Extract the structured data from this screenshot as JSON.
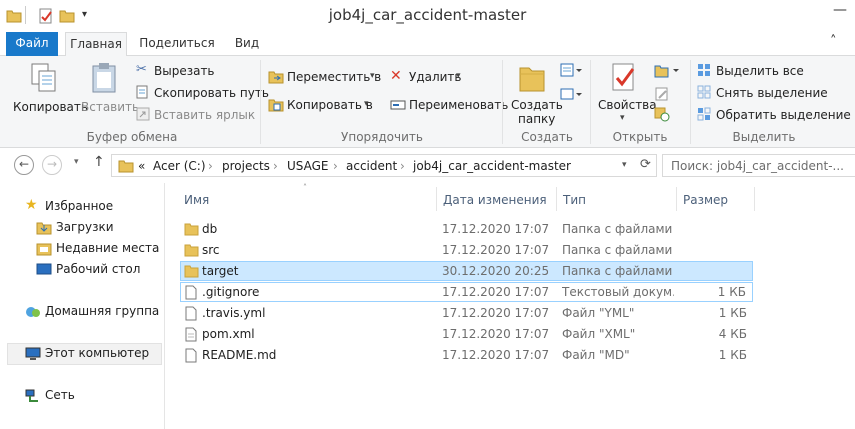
{
  "window": {
    "title": "job4j_car_accident-master",
    "minimize": "—",
    "expand_ribbon": "˄",
    "help": "?"
  },
  "ribbon_tabs": [
    "Файл",
    "Главная",
    "Поделиться",
    "Вид"
  ],
  "ribbon": {
    "clipboard": {
      "group_label": "Буфер обмена",
      "copy": "Копировать",
      "paste": "Вставить",
      "cut": "Вырезать",
      "copy_path": "Скопировать путь",
      "paste_shortcut": "Вставить ярлык"
    },
    "organize": {
      "group_label": "Упорядочить",
      "move_to": "Переместить в",
      "copy_to": "Копировать в",
      "delete": "Удалить",
      "rename": "Переименовать"
    },
    "new": {
      "group_label": "Создать",
      "new_folder_line1": "Создать",
      "new_folder_line2": "папку"
    },
    "open": {
      "group_label": "Открыть",
      "properties": "Свойства"
    },
    "select": {
      "group_label": "Выделить",
      "select_all": "Выделить все",
      "select_none": "Снять выделение",
      "invert": "Обратить выделение"
    }
  },
  "address": {
    "crumbs": [
      "«",
      "Acer (C:)",
      "projects",
      "USAGE",
      "accident",
      "job4j_car_accident-master"
    ],
    "search_placeholder": "Поиск: job4j_car_accident-..."
  },
  "nav": {
    "favorites": "Избранное",
    "downloads": "Загрузки",
    "recent": "Недавние места",
    "desktop": "Рабочий стол",
    "homegroup": "Домашняя группа",
    "this_pc": "Этот компьютер",
    "network": "Сеть"
  },
  "columns": {
    "name": "Имя",
    "date": "Дата изменения",
    "type": "Тип",
    "size": "Размер"
  },
  "files": [
    {
      "name": "db",
      "date": "17.12.2020 17:07",
      "type": "Папка с файлами",
      "size": "",
      "kind": "folder"
    },
    {
      "name": "src",
      "date": "17.12.2020 17:07",
      "type": "Папка с файлами",
      "size": "",
      "kind": "folder"
    },
    {
      "name": "target",
      "date": "30.12.2020 20:25",
      "type": "Папка с файлами",
      "size": "",
      "kind": "folder"
    },
    {
      "name": ".gitignore",
      "date": "17.12.2020 17:07",
      "type": "Текстовый докум...",
      "size": "1 КБ",
      "kind": "file"
    },
    {
      "name": ".travis.yml",
      "date": "17.12.2020 17:07",
      "type": "Файл \"YML\"",
      "size": "1 КБ",
      "kind": "file"
    },
    {
      "name": "pom.xml",
      "date": "17.12.2020 17:07",
      "type": "Файл \"XML\"",
      "size": "4 КБ",
      "kind": "file"
    },
    {
      "name": "README.md",
      "date": "17.12.2020 17:07",
      "type": "Файл \"MD\"",
      "size": "1 КБ",
      "kind": "file"
    }
  ],
  "colors": {
    "file_tab": "#1979ca",
    "selection": "#cce8ff",
    "selection_border": "#99d1ff",
    "folder": "#e8c25a"
  }
}
